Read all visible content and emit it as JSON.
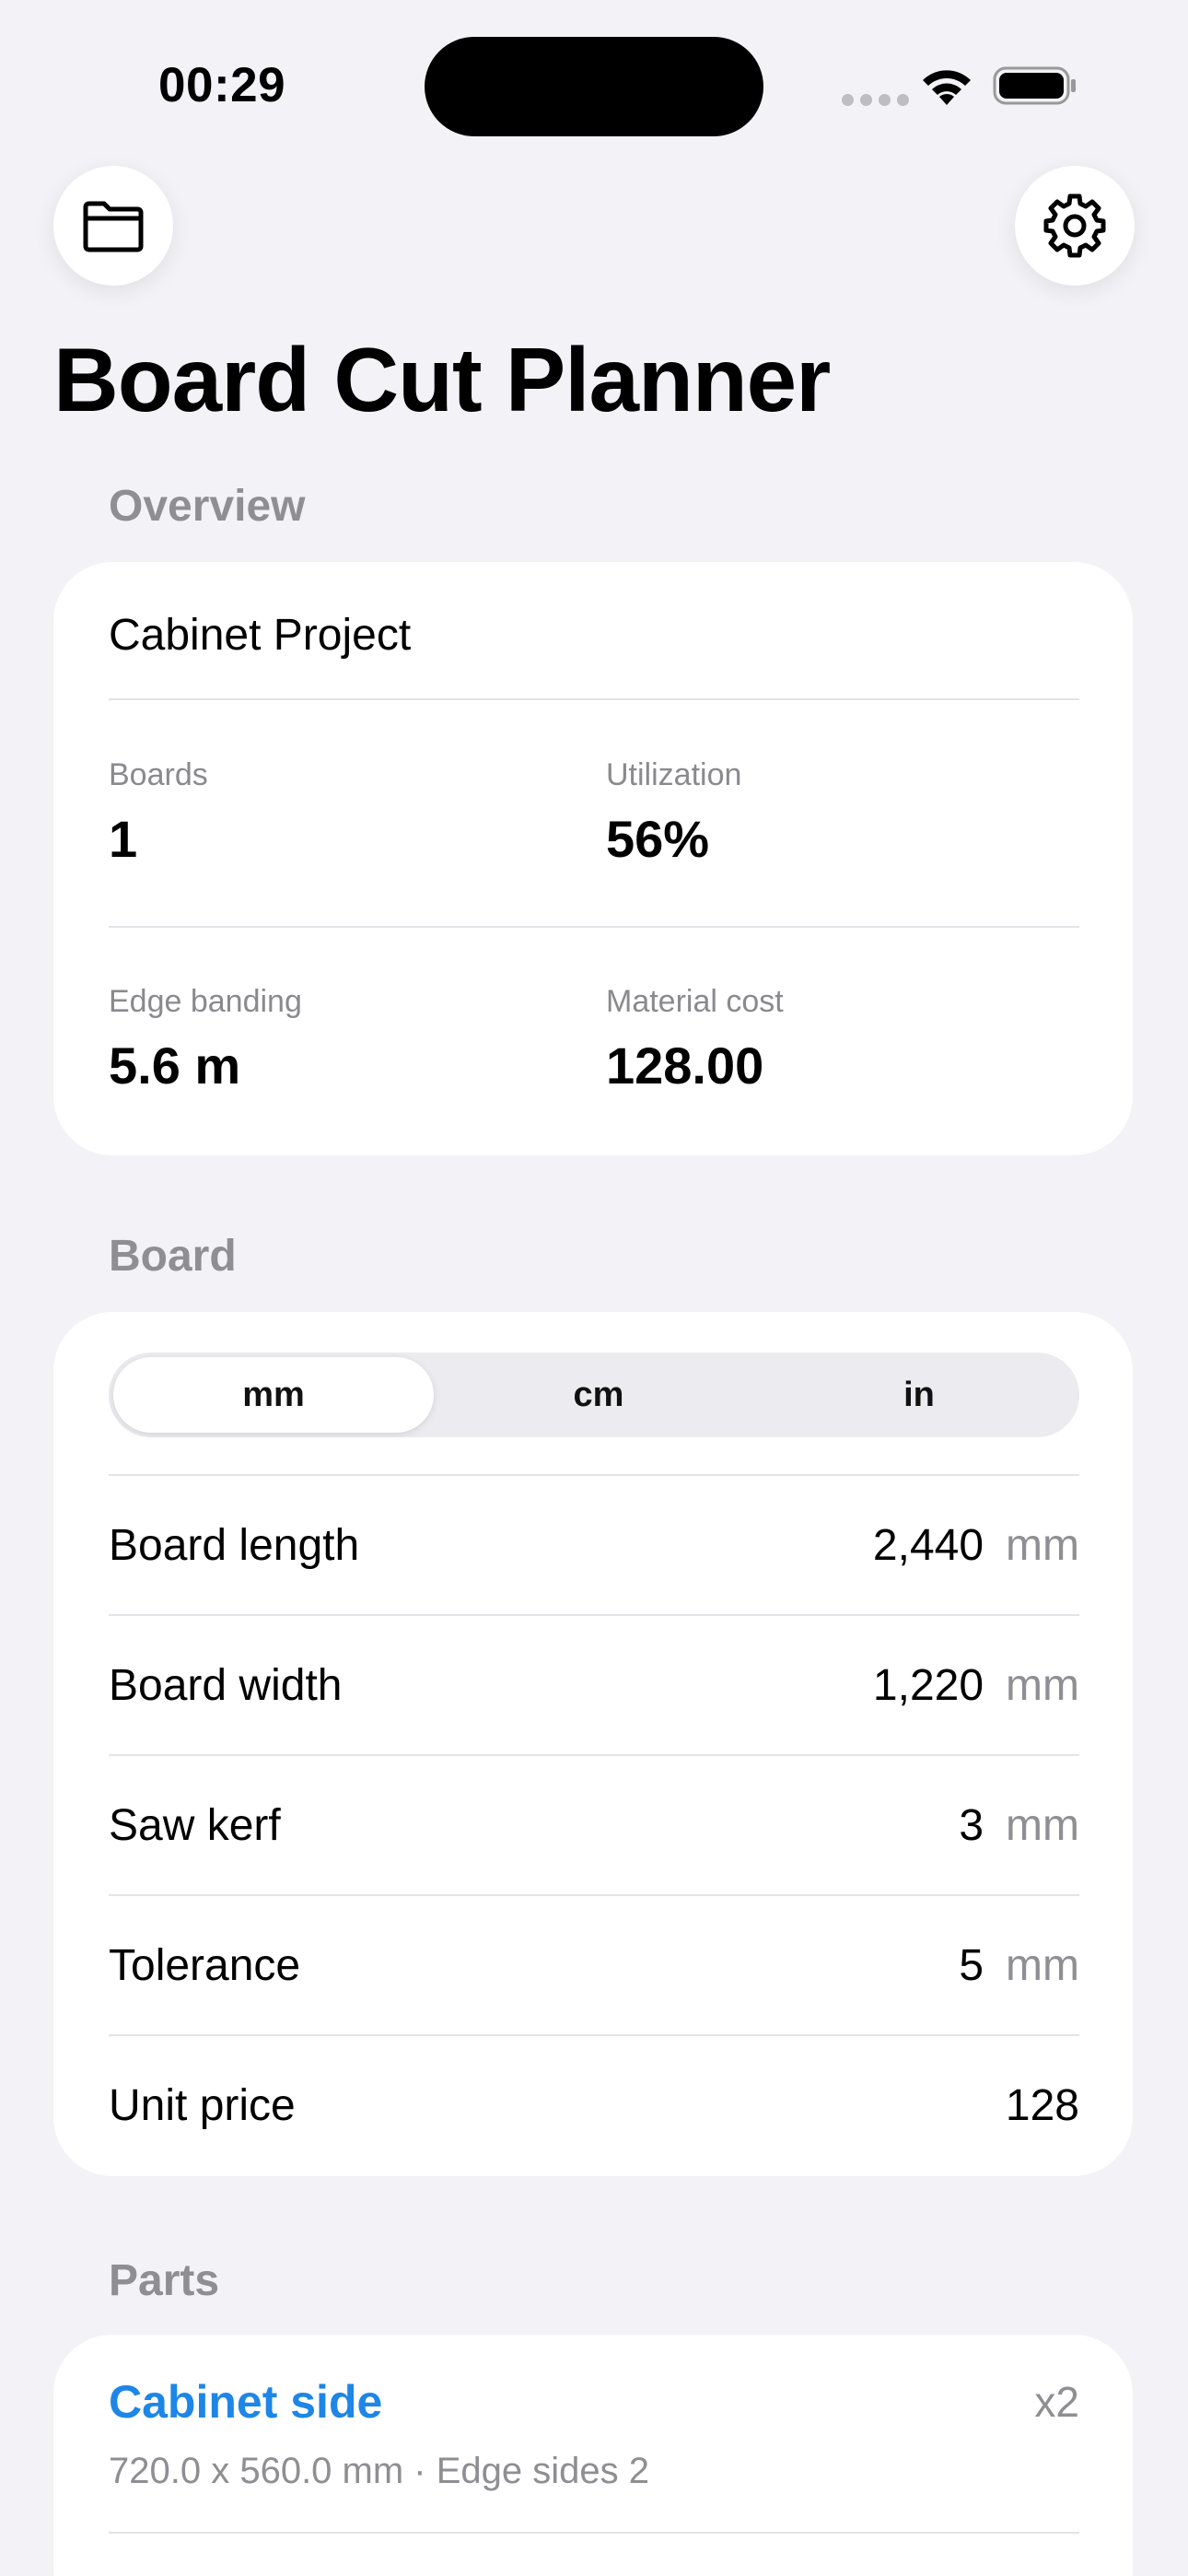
{
  "status_bar": {
    "time": "00:29"
  },
  "header": {
    "title": "Board Cut Planner",
    "left_icon": "folder-icon",
    "right_icon": "gear-icon"
  },
  "overview": {
    "section_title": "Overview",
    "project_name": "Cabinet Project",
    "stats": {
      "boards_label": "Boards",
      "boards_value": "1",
      "utilization_label": "Utilization",
      "utilization_value": "56%",
      "edge_label": "Edge banding",
      "edge_value": "5.6 m",
      "cost_label": "Material cost",
      "cost_value": "128.00"
    }
  },
  "board": {
    "section_title": "Board",
    "units": [
      "mm",
      "cm",
      "in"
    ],
    "selected_unit": "mm",
    "rows": [
      {
        "label": "Board length",
        "value": "2,440",
        "unit": "mm"
      },
      {
        "label": "Board width",
        "value": "1,220",
        "unit": "mm"
      },
      {
        "label": "Saw kerf",
        "value": "3",
        "unit": "mm"
      },
      {
        "label": "Tolerance",
        "value": "5",
        "unit": "mm"
      },
      {
        "label": "Unit price",
        "value": "128",
        "unit": ""
      }
    ]
  },
  "parts": {
    "section_title": "Parts",
    "items": [
      {
        "name": "Cabinet side",
        "quantity": "x2",
        "detail": "720.0 x 560.0 mm · Edge sides 2"
      }
    ]
  },
  "colors": {
    "accent": "#1E86E6",
    "background": "#F2F2F7",
    "secondary_text": "#8E8E93"
  }
}
